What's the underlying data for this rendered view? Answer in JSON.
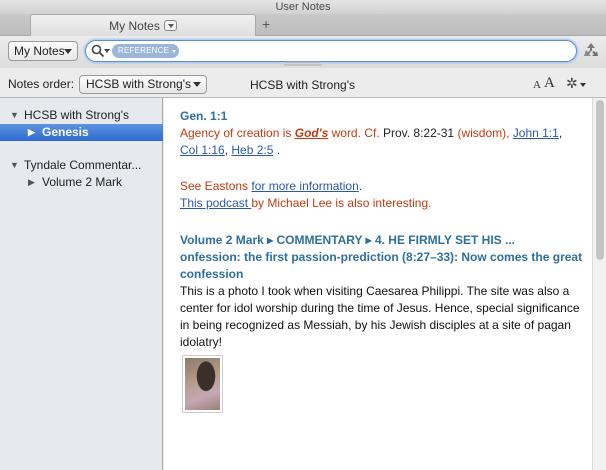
{
  "window": {
    "title": "User Notes"
  },
  "tab": {
    "label": "My Notes",
    "add_label": "+"
  },
  "toolbar": {
    "notes_button": "My Notes",
    "search_token": "REFERENCE"
  },
  "order_bar": {
    "label": "Notes order:",
    "selected": "HCSB with Strong's",
    "center_title": "HCSB with Strong's",
    "font_small": "A",
    "font_large": "A"
  },
  "sidebar": {
    "items": [
      {
        "label": "HCSB with Strong's",
        "expanded": true,
        "level": 0
      },
      {
        "label": "Genesis",
        "selected": true,
        "level": 1
      },
      {
        "label": "Tyndale Commentar...",
        "expanded": true,
        "level": 0
      },
      {
        "label": "Volume 2 Mark",
        "selected": false,
        "level": 1
      }
    ]
  },
  "content": {
    "note1": {
      "reference": "Gen. 1:1",
      "text_a": "Agency of creation is ",
      "gods": "God's",
      "text_b": " word. Cf. ",
      "prov": "Prov. 8:22-31",
      "wisdom": " (wisdom), ",
      "link_john": "John 1:1",
      "comma1": ", ",
      "link_col": "Col 1:16",
      "comma2": ", ",
      "link_heb": "Heb 2:5",
      "end": " ."
    },
    "note2": {
      "see": "See Eastons ",
      "link_more": "for more information",
      "period": ".",
      "link_podcast": "This podcast ",
      "podcast_rest": "by Michael Lee is also interesting."
    },
    "note3": {
      "heading1": "Volume 2 Mark ▸ COMMENTARY ▸ 4. HE FIRMLY SET HIS ...",
      "heading2": "onfession: the first passion-prediction (8:27–33): Now comes the great confession",
      "body": "This is a photo I took when visiting Caesarea Philippi. The site was also a center for idol worship during the time of Jesus. Hence, special significance in being recognized as Messiah, by his Jewish disciples at a site of pagan idolatry!"
    }
  },
  "icons": [
    "search-icon",
    "sync-icon",
    "gear-icon",
    "disclosure-triangle-icon"
  ],
  "colors": {
    "selection": "#3a75d6",
    "link": "#2a57b4",
    "note_red": "#c13b10",
    "heading_blue": "#2e6f9e"
  }
}
